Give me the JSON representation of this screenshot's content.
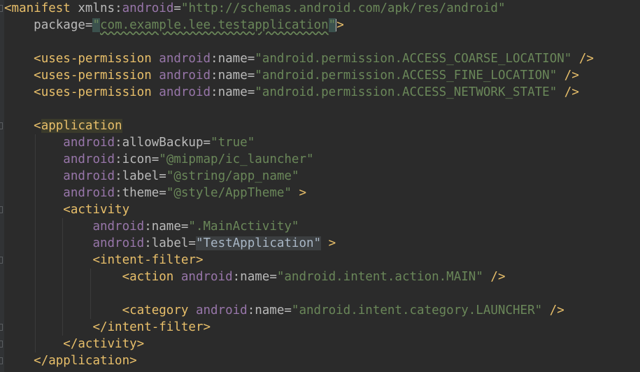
{
  "editor": {
    "lines": [
      {
        "indent": "",
        "parts": [
          {
            "t": "<",
            "c": "tag"
          },
          {
            "t": "manifest ",
            "c": "tag"
          },
          {
            "t": "xmlns",
            "c": "attr"
          },
          {
            "t": ":",
            "c": "attr"
          },
          {
            "t": "android",
            "c": "ns"
          },
          {
            "t": "=",
            "c": "attr"
          },
          {
            "t": "\"http://schemas.android.com/apk/res/android\"",
            "c": "str"
          }
        ]
      },
      {
        "indent": "    ",
        "parts": [
          {
            "t": "package",
            "c": "attr"
          },
          {
            "t": "=",
            "c": "attr"
          },
          {
            "t": "\"",
            "c": "str pkg-quote"
          },
          {
            "t": "com.example.lee.testapplication",
            "c": "str squiggle"
          },
          {
            "t": "\"",
            "c": "str pkg-quote"
          },
          {
            "t": ">",
            "c": "tag"
          }
        ]
      },
      {
        "indent": "",
        "parts": []
      },
      {
        "indent": "    ",
        "parts": [
          {
            "t": "<uses-permission ",
            "c": "tag"
          },
          {
            "t": "android",
            "c": "ns"
          },
          {
            "t": ":name=",
            "c": "attr"
          },
          {
            "t": "\"android.permission.ACCESS_COARSE_LOCATION\"",
            "c": "str"
          },
          {
            "t": " />",
            "c": "tag"
          }
        ]
      },
      {
        "indent": "    ",
        "parts": [
          {
            "t": "<uses-permission ",
            "c": "tag"
          },
          {
            "t": "android",
            "c": "ns"
          },
          {
            "t": ":name=",
            "c": "attr"
          },
          {
            "t": "\"android.permission.ACCESS_FINE_LOCATION\"",
            "c": "str"
          },
          {
            "t": " />",
            "c": "tag"
          }
        ]
      },
      {
        "indent": "    ",
        "parts": [
          {
            "t": "<uses-permission ",
            "c": "tag"
          },
          {
            "t": "android",
            "c": "ns"
          },
          {
            "t": ":name=",
            "c": "attr"
          },
          {
            "t": "\"android.permission.ACCESS_NETWORK_STATE\"",
            "c": "str"
          },
          {
            "t": " />",
            "c": "tag"
          }
        ]
      },
      {
        "indent": "",
        "parts": []
      },
      {
        "indent": "    ",
        "parts": [
          {
            "t": "<",
            "c": "tag"
          },
          {
            "t": "application",
            "c": "tag hl-tag"
          }
        ]
      },
      {
        "indent": "        ",
        "parts": [
          {
            "t": "android",
            "c": "ns"
          },
          {
            "t": ":allowBackup=",
            "c": "attr"
          },
          {
            "t": "\"true\"",
            "c": "str"
          }
        ]
      },
      {
        "indent": "        ",
        "parts": [
          {
            "t": "android",
            "c": "ns"
          },
          {
            "t": ":icon=",
            "c": "attr"
          },
          {
            "t": "\"@mipmap/ic_launcher\"",
            "c": "str"
          }
        ]
      },
      {
        "indent": "        ",
        "parts": [
          {
            "t": "android",
            "c": "ns"
          },
          {
            "t": ":label=",
            "c": "attr"
          },
          {
            "t": "\"@string/app_name\"",
            "c": "str"
          }
        ]
      },
      {
        "indent": "        ",
        "parts": [
          {
            "t": "android",
            "c": "ns"
          },
          {
            "t": ":theme=",
            "c": "attr"
          },
          {
            "t": "\"@style/AppTheme\"",
            "c": "str"
          },
          {
            "t": " >",
            "c": "tag"
          }
        ]
      },
      {
        "indent": "        ",
        "parts": [
          {
            "t": "<activity",
            "c": "tag"
          }
        ]
      },
      {
        "indent": "            ",
        "parts": [
          {
            "t": "android",
            "c": "ns"
          },
          {
            "t": ":name=",
            "c": "attr"
          },
          {
            "t": "\".MainActivity\"",
            "c": "str"
          }
        ]
      },
      {
        "indent": "            ",
        "parts": [
          {
            "t": "android",
            "c": "ns"
          },
          {
            "t": ":label=",
            "c": "attr"
          },
          {
            "t": "\"TestApplication\"",
            "c": "plain hl-str"
          },
          {
            "t": " >",
            "c": "tag"
          }
        ]
      },
      {
        "indent": "            ",
        "parts": [
          {
            "t": "<intent-filter>",
            "c": "tag"
          }
        ]
      },
      {
        "indent": "                ",
        "parts": [
          {
            "t": "<action ",
            "c": "tag"
          },
          {
            "t": "android",
            "c": "ns"
          },
          {
            "t": ":name=",
            "c": "attr"
          },
          {
            "t": "\"android.intent.action.MAIN\"",
            "c": "str"
          },
          {
            "t": " />",
            "c": "tag"
          }
        ]
      },
      {
        "indent": "",
        "parts": []
      },
      {
        "indent": "                ",
        "parts": [
          {
            "t": "<category ",
            "c": "tag"
          },
          {
            "t": "android",
            "c": "ns"
          },
          {
            "t": ":name=",
            "c": "attr"
          },
          {
            "t": "\"android.intent.category.LAUNCHER\"",
            "c": "str"
          },
          {
            "t": " />",
            "c": "tag"
          }
        ]
      },
      {
        "indent": "            ",
        "parts": [
          {
            "t": "</intent-filter>",
            "c": "tag"
          }
        ]
      },
      {
        "indent": "        ",
        "parts": [
          {
            "t": "</activity>",
            "c": "tag"
          }
        ]
      },
      {
        "indent": "    ",
        "parts": [
          {
            "t": "</application>",
            "c": "tag"
          }
        ]
      }
    ]
  }
}
